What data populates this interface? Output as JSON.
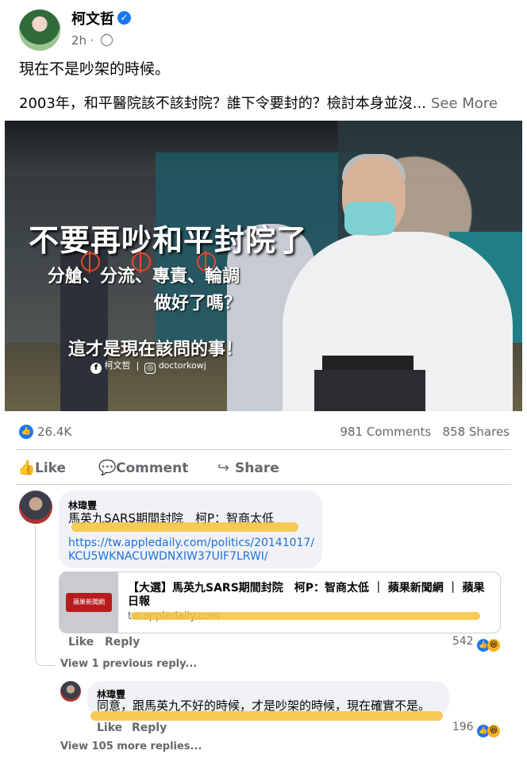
{
  "post": {
    "author": "柯文哲",
    "time": "2h",
    "line1": "現在不是吵架的時候。",
    "line2": "2003年，和平醫院該不該封院？誰下令要封的？檢討本身並沒...",
    "see_more": "See More"
  },
  "image": {
    "title": "不要再吵和平封院了",
    "sub1": "分艙、分流、專責、輪調",
    "sub2": "做好了嗎？",
    "sub3": "這才是現在該問的事！",
    "fb_name": "柯文哲",
    "ig_handle": "doctorkowj"
  },
  "stats": {
    "likes": "26.4K",
    "comments": "981 Comments",
    "shares": "858 Shares"
  },
  "actions": {
    "like": "Like",
    "comment": "Comment",
    "share": "Share"
  },
  "comment1": {
    "name": "林瑋豐",
    "text": "馬英九SARS期間封院　柯P：智商太低",
    "link_line1": "https://tw.appledaily.com/politics/20141017/",
    "link_line2": "KCU5WKNACUWDNXIW37UIF7LRWI/",
    "preview_logo": "蘋果新聞網",
    "preview_title": "【大選】馬英九SARS期間封院　柯P：智商太低 ｜ 蘋果新聞網 ｜ 蘋果日報",
    "preview_domain": "tw.appledaily.com",
    "like": "Like",
    "reply": "Reply",
    "reactions": "542"
  },
  "view_previous": "View 1 previous reply...",
  "comment2": {
    "name": "林瑋豐",
    "text": "同意，跟馬英九不好的時候，才是吵架的時候，現在確實不是。",
    "like": "Like",
    "reply": "Reply",
    "reactions": "196"
  },
  "view_more": "View 105 more replies...",
  "colors": {
    "accent": "#1877f2",
    "highlight": "#f6c338",
    "link": "#216fdb"
  }
}
